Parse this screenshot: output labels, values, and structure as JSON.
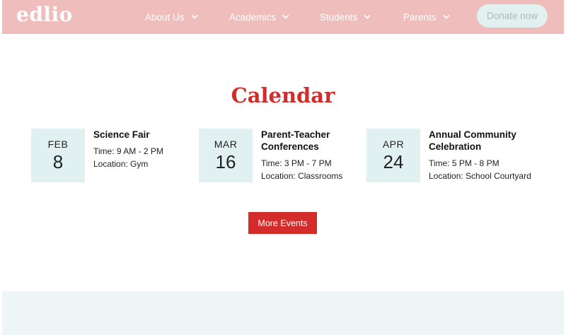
{
  "header": {
    "logo": "edlio",
    "nav": [
      {
        "label": "About Us"
      },
      {
        "label": "Academics"
      },
      {
        "label": "Students"
      },
      {
        "label": "Parents"
      }
    ],
    "donate_label": "Donate now",
    "colors": {
      "background": "#f0bdbd",
      "donate_bg": "#e3f0f0",
      "donate_text": "#a9bcbc"
    }
  },
  "calendar": {
    "title": "Calendar",
    "events": [
      {
        "month": "FEB",
        "day": "8",
        "title": "Science Fair",
        "time": "Time: 9 AM - 2 PM",
        "location": "Location: Gym"
      },
      {
        "month": "MAR",
        "day": "16",
        "title": "Parent-Teacher Conferences",
        "time": "Time: 3 PM - 7 PM",
        "location": "Location: Classrooms"
      },
      {
        "month": "APR",
        "day": "24",
        "title": "Annual Community Celebration",
        "time": "Time: 5 PM - 8 PM",
        "location": "Location: School Courtyard"
      }
    ],
    "more_label": "More Events",
    "colors": {
      "accent": "#d42b2b",
      "date_box": "#e1f0f0"
    }
  },
  "icons": {
    "nav_dropdown": "chevron-down-icon"
  }
}
